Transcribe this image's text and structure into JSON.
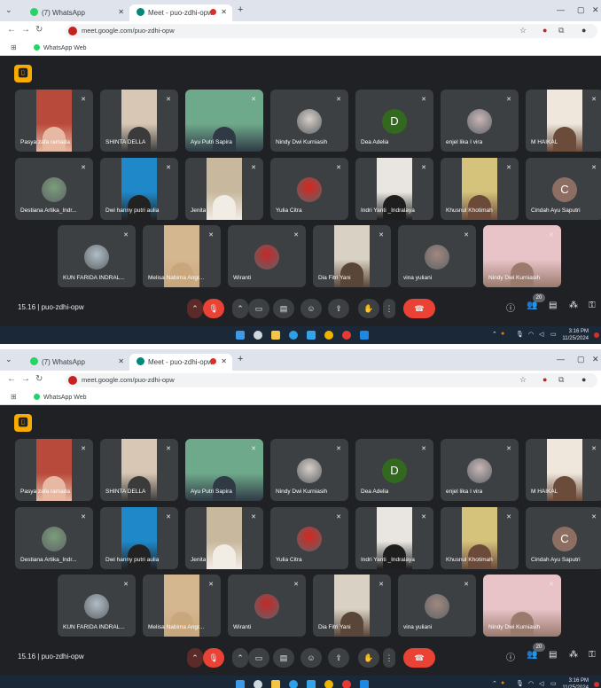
{
  "browser": {
    "tabs": [
      {
        "label": "(7) WhatsApp",
        "favicon_color": "#25d366"
      },
      {
        "label": "Meet - puo-zdhi-opw",
        "favicon_color": "#00897b"
      }
    ],
    "url": "meet.google.com/puo-zdhi-opw",
    "bookmark": "WhatsApp Web"
  },
  "meet": {
    "host_badge": "🅱",
    "time": "15.16",
    "separator": "|",
    "code": "puo-zdhi-opw",
    "participant_count": "20",
    "tiles": [
      {
        "name": "Pasya zafa ramada",
        "kind": "video",
        "colors": [
          "#b84a3b",
          "#e7b9a3"
        ]
      },
      {
        "name": "SHINTA DELLA",
        "kind": "video",
        "colors": [
          "#d9c7b5",
          "#3b3b3b"
        ]
      },
      {
        "name": "Ayu Putri Sapira",
        "kind": "videofull",
        "colors": [
          "#6fa98b",
          "#2f3a45"
        ]
      },
      {
        "name": "Nindy Dwi Kurniasih",
        "kind": "photo",
        "colors": [
          "#d7cfc7"
        ]
      },
      {
        "name": "Dea Adelia",
        "kind": "letter",
        "letter": "D",
        "colors": [
          "#33691e"
        ]
      },
      {
        "name": "enjel lika I vira",
        "kind": "photo",
        "colors": [
          "#c9b7b7"
        ]
      },
      {
        "name": "M HAIKAL",
        "kind": "video",
        "colors": [
          "#efe7dc",
          "#6b4b3a"
        ]
      },
      {
        "name": "Destiana Artika_Indr...",
        "kind": "photo",
        "colors": [
          "#7b9e7a"
        ]
      },
      {
        "name": "Dwi hanny putri aulia",
        "kind": "video",
        "colors": [
          "#1f88c9",
          "#222222"
        ]
      },
      {
        "name": "Jenita",
        "kind": "video",
        "colors": [
          "#c8b89e",
          "#f1ece4"
        ]
      },
      {
        "name": "Yulia Citra",
        "kind": "photo",
        "colors": [
          "#d7261e"
        ]
      },
      {
        "name": "Indri Yanti _Indralaya",
        "kind": "video",
        "colors": [
          "#e9e6e1",
          "#1e1e1e"
        ]
      },
      {
        "name": "Khusnul Khotimah",
        "kind": "video",
        "colors": [
          "#d5c27b",
          "#6b4a3a"
        ]
      },
      {
        "name": "Cindah Ayu Saputri",
        "kind": "letter",
        "letter": "C",
        "colors": [
          "#8d6e63"
        ]
      },
      {
        "name": "KUN FARIDA INDRAL...",
        "kind": "photo",
        "colors": [
          "#b0bec5"
        ]
      },
      {
        "name": "Melisa Nabima Angr...",
        "kind": "video",
        "colors": [
          "#d4b68f",
          "#c9a77c"
        ]
      },
      {
        "name": "Wiranti",
        "kind": "photo",
        "colors": [
          "#c62828"
        ]
      },
      {
        "name": "Dia Fitri Yani",
        "kind": "video",
        "colors": [
          "#d9d2c4",
          "#5a4638"
        ]
      },
      {
        "name": "vina yuliani",
        "kind": "photo",
        "colors": [
          "#a1887f"
        ]
      },
      {
        "name": "Nindy Dwi Kurniasih",
        "kind": "videofull",
        "colors": [
          "#e8c4c8",
          "#9b7a6e"
        ]
      }
    ]
  },
  "taskbar": {
    "time": "3:16 PM",
    "date": "11/25/2024"
  },
  "icons": {
    "mic_off": "mic-off-icon",
    "camera": "camera-icon",
    "captions": "captions-icon",
    "emoji": "emoji-icon",
    "present": "present-icon",
    "hand": "raise-hand-icon",
    "more": "more-icon",
    "end": "end-call-icon",
    "info": "info-icon",
    "people": "people-icon",
    "chat": "chat-icon",
    "activities": "activities-icon",
    "lock": "host-controls-icon"
  }
}
